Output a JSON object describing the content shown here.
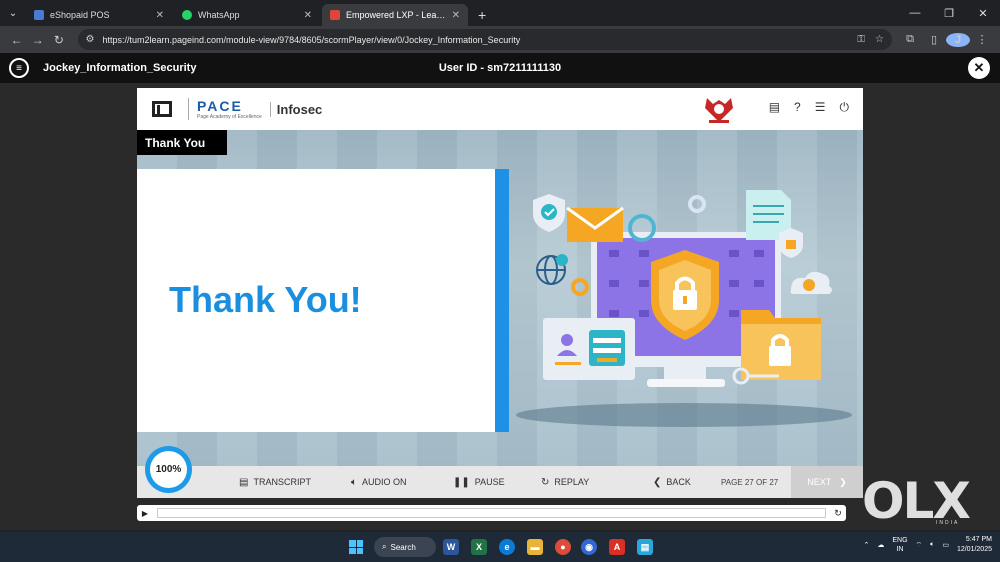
{
  "browser": {
    "tabs": [
      {
        "title": "eShopaid POS",
        "favicon_color": "#4a7bd4",
        "active": false
      },
      {
        "title": "WhatsApp",
        "favicon_color": "#25d366",
        "active": false
      },
      {
        "title": "Empowered LXP - Learning Expe",
        "favicon_color": "#e0453a",
        "active": true
      }
    ],
    "new_tab": "+",
    "url": "https://tum2learn.pageind.com/module-view/9784/8605/scormPlayer/view/0/Jockey_Information_Security",
    "profile_initial": "J"
  },
  "player": {
    "course_title": "Jockey_Information_Security",
    "user_id": "User ID - sm7211111130"
  },
  "course": {
    "brand_main": "PACE",
    "brand_sub": "Page Academy of Excellence",
    "section": "Infosec",
    "slide_tab": "Thank You",
    "headline": "Thank You!",
    "progress_label": "100%",
    "controls": {
      "transcript": "TRANSCRIPT",
      "audio": "AUDIO ON",
      "pause": "PAUSE",
      "replay": "REPLAY",
      "back": "BACK",
      "page": "PAGE 27 OF 27",
      "next": "NEXT"
    }
  },
  "watermark": {
    "main": "OLX",
    "sub": "INDIA"
  },
  "taskbar": {
    "search_label": "Search",
    "lang_top": "ENG",
    "lang_bottom": "IN",
    "time": "5:47 PM",
    "date": "12/01/2025"
  },
  "colors": {
    "accent_blue": "#1e90e6",
    "headline_blue": "#1a8fe0"
  }
}
